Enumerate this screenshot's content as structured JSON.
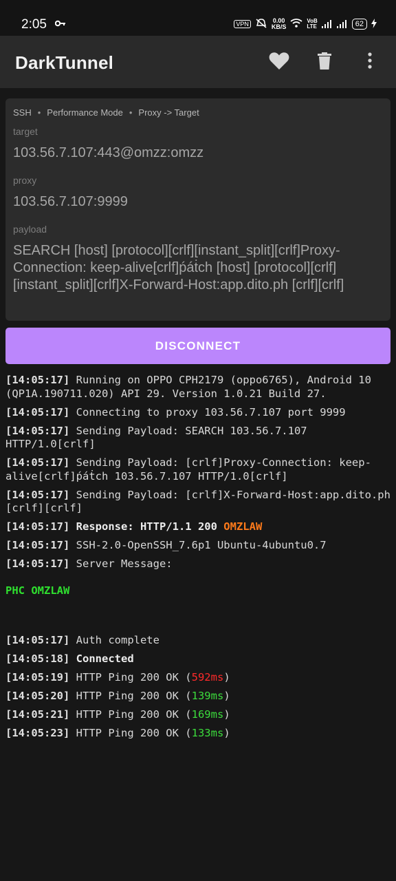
{
  "status_bar": {
    "time": "2:05",
    "key_icon": "key-icon",
    "vpn": "VPN",
    "speed_value": "0.00",
    "speed_unit": "KB/S",
    "volte_top": "VoB",
    "volte_bottom": "LTE",
    "battery": "62"
  },
  "app_bar": {
    "title": "DarkTunnel",
    "icons": [
      "heart-icon",
      "trash-icon",
      "more-vert-icon"
    ]
  },
  "config": {
    "crumbs": [
      "SSH",
      "Performance Mode",
      "Proxy -> Target"
    ],
    "target_label": "target",
    "target_value": "103.56.7.107:443@omzz:omzz",
    "proxy_label": "proxy",
    "proxy_value": "103.56.7.107:9999",
    "payload_label": "payload",
    "payload_value": "SEARCH [host] [protocol][crlf][instant_split][crlf]Proxy-Connection: keep-alive[crlf]ṕáṫch [host] [protocol][crlf][instant_split][crlf]X-Forward-Host:app.dito.ph [crlf][crlf]"
  },
  "disconnect_label": "DISCONNECT",
  "log": {
    "l1_ts": "[14:05:17]",
    "l1_text": " Running on OPPO CPH2179 (oppo6765), Android 10 (QP1A.190711.020) API 29. Version 1.0.21 Build 27.",
    "l2_ts": "[14:05:17]",
    "l2_text": " Connecting to proxy 103.56.7.107 port 9999",
    "l3_ts": "[14:05:17]",
    "l3_text": " Sending Payload: SEARCH 103.56.7.107 HTTP/1.0[crlf]",
    "l4_ts": "[14:05:17]",
    "l4_text": " Sending Payload: [crlf]Proxy-Connection: keep-alive[crlf]ṕáṫch 103.56.7.107 HTTP/1.0[crlf]",
    "l5_ts": "[14:05:17]",
    "l5_text": " Sending Payload: [crlf]X-Forward-Host:app.dito.ph [crlf][crlf]",
    "l6_ts": "[14:05:17]",
    "l6_text": " Response: HTTP/1.1 200 ",
    "l6_highlight": "OMZLAW",
    "l7_ts": "[14:05:17]",
    "l7_text": " SSH-2.0-OpenSSH_7.6p1 Ubuntu-4ubuntu0.7",
    "l8_ts": "[14:05:17]",
    "l8_text": " Server Message:",
    "server_message": "PHC OMZLAW",
    "l9_ts": "[14:05:17]",
    "l9_text": " Auth complete",
    "l10_ts": "[14:05:18]",
    "l10_text": " Connected",
    "l11_ts": "[14:05:19]",
    "l11_pre": " HTTP Ping 200 OK (",
    "l11_ms": "592ms",
    "l11_post": ")",
    "l12_ts": "[14:05:20]",
    "l12_pre": " HTTP Ping 200 OK (",
    "l12_ms": "139ms",
    "l12_post": ")",
    "l13_ts": "[14:05:21]",
    "l13_pre": " HTTP Ping 200 OK (",
    "l13_ms": "169ms",
    "l13_post": ")",
    "l14_ts": "[14:05:23]",
    "l14_pre": " HTTP Ping 200 OK (",
    "l14_ms": "133ms",
    "l14_post": ")"
  },
  "colors": {
    "accent": "#bb86fc",
    "highlight_orange": "#ff7a1a",
    "ping_slow": "#ff2a2a",
    "ping_ok": "#3cdc3c"
  }
}
